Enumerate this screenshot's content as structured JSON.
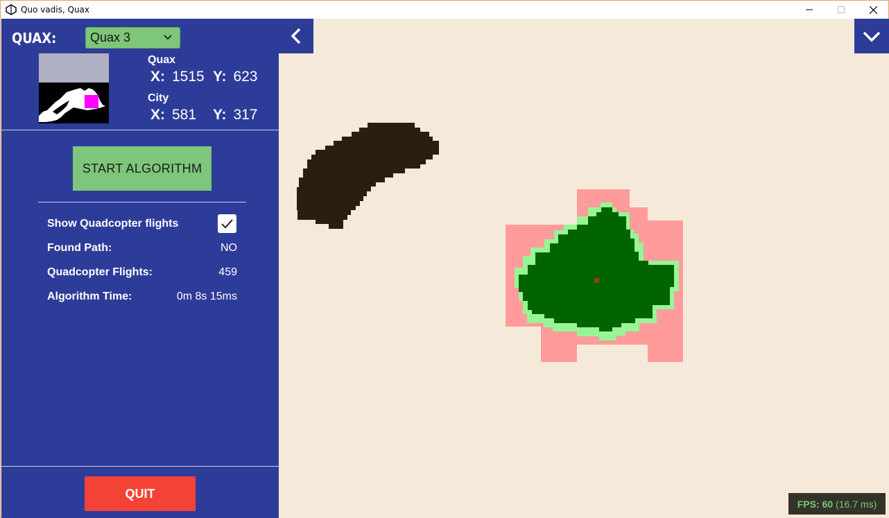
{
  "window": {
    "title": "Quo vadis, Quax"
  },
  "panel": {
    "quax_label": "QUAX:",
    "quax_selected": "Quax 3",
    "quax_position": {
      "label": "Quax",
      "x_label": "X:",
      "x": "1515",
      "y_label": "Y:",
      "y": "623"
    },
    "city_position": {
      "label": "City",
      "x_label": "X:",
      "x": "581",
      "y_label": "Y:",
      "y": "317"
    },
    "start_button": "START ALGORITHM",
    "rows": [
      {
        "label": "Show Quadcopter flights",
        "value": ""
      },
      {
        "label": "Found Path:",
        "value": "NO"
      },
      {
        "label": "Quadcopter Flights:",
        "value": "459"
      },
      {
        "label": "Algorithm Time:",
        "value": "0m 8s 15ms"
      }
    ],
    "show_flights_checked": true,
    "quit_button": "QUIT"
  },
  "fps": {
    "label": "FPS: 60",
    "detail": "(16.7 ms)"
  },
  "colors": {
    "panel": "#2e3c99",
    "accent_green": "#7ec67a",
    "quit_red": "#f44336",
    "map_bg": "#f5ead9",
    "obstacle": "#2a1f0e",
    "explored": "#ff9b9b",
    "region_border": "#98f596",
    "region": "#006400",
    "city_marker": "#8b4513",
    "minimap_marker": "#ff00ff"
  },
  "icons": [
    "app-icon",
    "minimize-icon",
    "maximize-icon",
    "close-icon",
    "chevron-down-icon",
    "chevron-left-icon",
    "checkmark-icon"
  ]
}
